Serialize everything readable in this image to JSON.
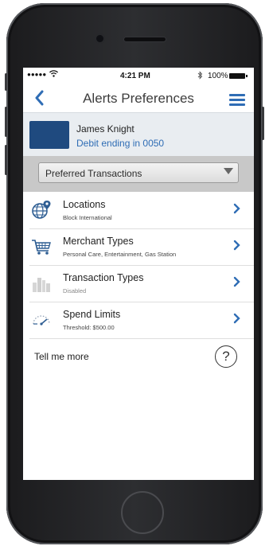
{
  "status_bar": {
    "signal": "●●●●●",
    "time": "4:21 PM",
    "battery": "100%"
  },
  "nav": {
    "title": "Alerts Preferences"
  },
  "account": {
    "name": "James Knight",
    "card_desc": "Debit ending in 0050"
  },
  "filter": {
    "selected": "Preferred Transactions"
  },
  "alerts": [
    {
      "title": "Locations",
      "subtitle": "Block International",
      "icon": "globe-pin-icon",
      "enabled": true
    },
    {
      "title": "Merchant Types",
      "subtitle": "Personal Care, Entertainment, Gas Station",
      "icon": "shopping-cart-icon",
      "enabled": true
    },
    {
      "title": "Transaction Types",
      "subtitle": "Disabled",
      "icon": "city-buildings-icon",
      "enabled": false
    },
    {
      "title": "Spend Limits",
      "subtitle": "Threshold: $500.00",
      "icon": "gauge-icon",
      "enabled": true
    }
  ],
  "help": {
    "text": "Tell me more",
    "icon_text": "?"
  },
  "colors": {
    "accent": "#2f6db5",
    "card": "#1f4a7f"
  }
}
